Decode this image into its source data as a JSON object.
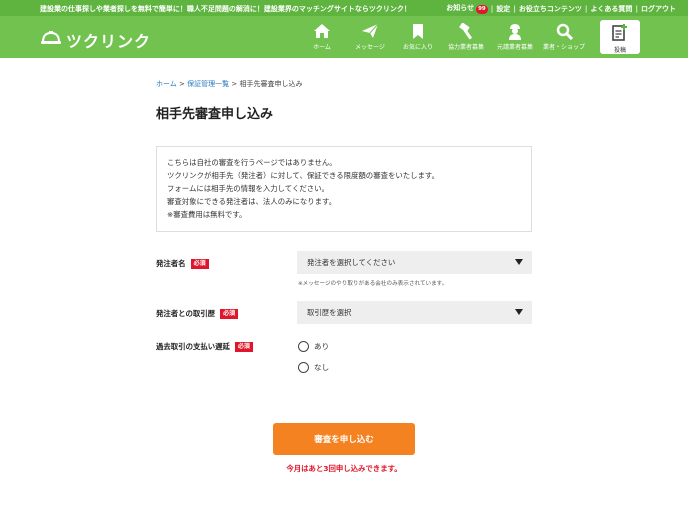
{
  "topbar": {
    "tagline": "建設業の仕事探しや業者探しを無料で簡単に！職人不足問題の解消に！建設業界のマッチングサイトならツクリンク！",
    "notifications_label": "お知らせ",
    "notifications_count": "99",
    "settings_label": "設定",
    "useful_label": "お役立ちコンテンツ",
    "faq_label": "よくある質問",
    "logout_label": "ログアウト"
  },
  "header": {
    "logo_text": "ツクリンク",
    "nav": {
      "home": "ホーム",
      "message": "メッセージ",
      "favorites": "お気に入り",
      "partner_recruit": "協力業者募集",
      "prime_recruit": "元請業者募集",
      "shop": "業者・ショップ"
    },
    "post_label": "投稿"
  },
  "breadcrumb": {
    "home": "ホーム",
    "sep1": " > ",
    "guarantee_list": "保証管理一覧",
    "sep2": " > ",
    "current": "相手先審査申し込み"
  },
  "page": {
    "title": "相手先審査申し込み"
  },
  "info": {
    "line1": "こちらは自社の審査を行うページではありません。",
    "line2": "ツクリンクが相手先（発注者）に対して、保証できる限度額の審査をいたします。",
    "line3": "フォームには相手先の情報を入力してください。",
    "line4": "審査対象にできる発注者は、法人のみになります。",
    "line5": "※審査費用は無料です。"
  },
  "form": {
    "required_label": "必須",
    "client": {
      "label": "発注者名",
      "value": "発注者を選択してください",
      "note": "※メッセージのやり取りがある会社のみ表示されています。"
    },
    "history": {
      "label": "発注者との取引歴",
      "value": "取引歴を選択"
    },
    "delay": {
      "label": "過去取引の支払い遅延",
      "option_yes": "あり",
      "option_no": "なし"
    },
    "submit_label": "審査を申し込む",
    "remaining_text": "今月はあと3回申し込みできます。"
  },
  "colors": {
    "brand_green": "#72c250",
    "top_green": "#5fb43f",
    "accent_orange": "#f58220",
    "required_red": "#e0162b"
  }
}
